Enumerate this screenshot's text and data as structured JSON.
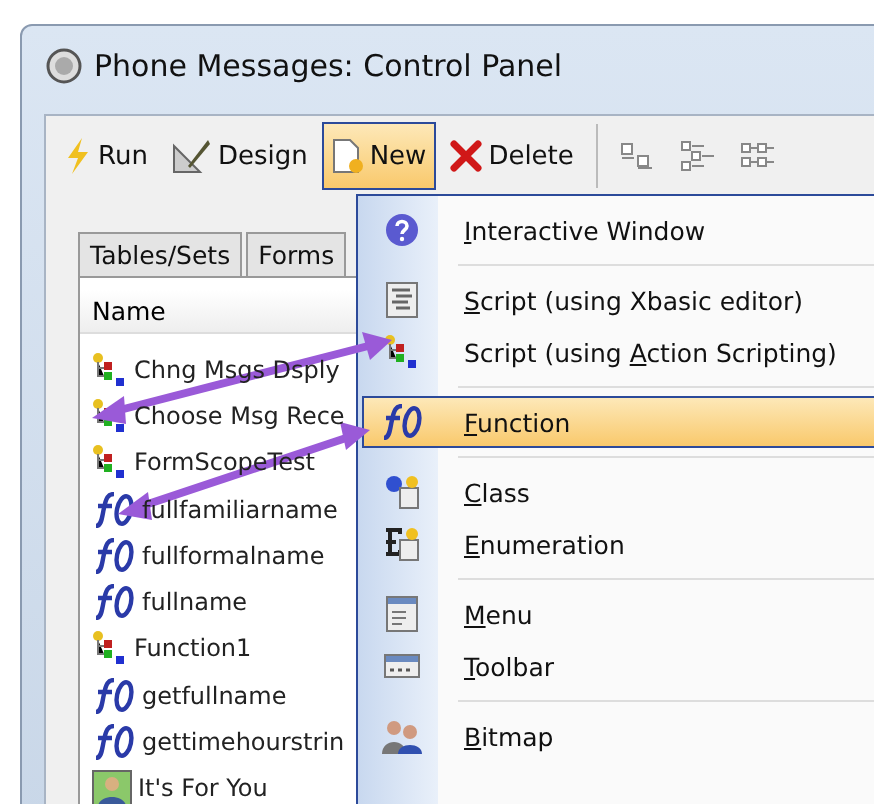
{
  "window": {
    "title": "Phone Messages: Control Panel"
  },
  "toolbar": [
    {
      "kind": "run",
      "label": "Run",
      "selected": false
    },
    {
      "kind": "design",
      "label": "Design",
      "selected": false
    },
    {
      "kind": "new",
      "label": "New",
      "selected": true
    },
    {
      "kind": "delete",
      "label": "Delete",
      "selected": false
    },
    {
      "kind": "layout1",
      "selected": false
    },
    {
      "kind": "layout2",
      "selected": false
    },
    {
      "kind": "layout3",
      "selected": false
    }
  ],
  "tabs": [
    {
      "label": "Tables/Sets",
      "selected": false
    },
    {
      "label": "Forms",
      "selected": false
    }
  ],
  "list": {
    "header": "Name",
    "rows": [
      {
        "kind": "script",
        "name": "Chng Msgs Dsply"
      },
      {
        "kind": "script",
        "name": "Choose Msg Rece"
      },
      {
        "kind": "script",
        "name": "FormScopeTest"
      },
      {
        "kind": "function",
        "name": "fullfamiliarname"
      },
      {
        "kind": "function",
        "name": "fullformalname"
      },
      {
        "kind": "function",
        "name": "fullname"
      },
      {
        "kind": "script",
        "name": "Function1"
      },
      {
        "kind": "function",
        "name": "getfullname"
      },
      {
        "kind": "function",
        "name": "gettimehourstrin"
      },
      {
        "kind": "form",
        "name": "It's For You"
      }
    ]
  },
  "menu": {
    "groups": [
      [
        {
          "kind": "help",
          "key": "I",
          "after": "nteractive Window",
          "selected": false
        }
      ],
      [
        {
          "kind": "xbasic",
          "key": "S",
          "after": "cript (using Xbasic editor)",
          "selected": false
        },
        {
          "kind": "script",
          "before": "Script (using ",
          "key": "A",
          "after": "ction Scripting)",
          "selected": false
        }
      ],
      [
        {
          "kind": "function",
          "key": "F",
          "after": "unction",
          "selected": true
        }
      ],
      [
        {
          "kind": "class",
          "key": "C",
          "after": "lass",
          "selected": false
        },
        {
          "kind": "enumeration",
          "key": "E",
          "after": "numeration",
          "selected": false
        }
      ],
      [
        {
          "kind": "menu",
          "key": "M",
          "after": "enu",
          "selected": false
        },
        {
          "kind": "toolbar",
          "key": "T",
          "after": "oolbar",
          "selected": false
        }
      ],
      [
        {
          "kind": "bitmap",
          "key": "B",
          "after": "itmap",
          "selected": false
        }
      ]
    ]
  }
}
